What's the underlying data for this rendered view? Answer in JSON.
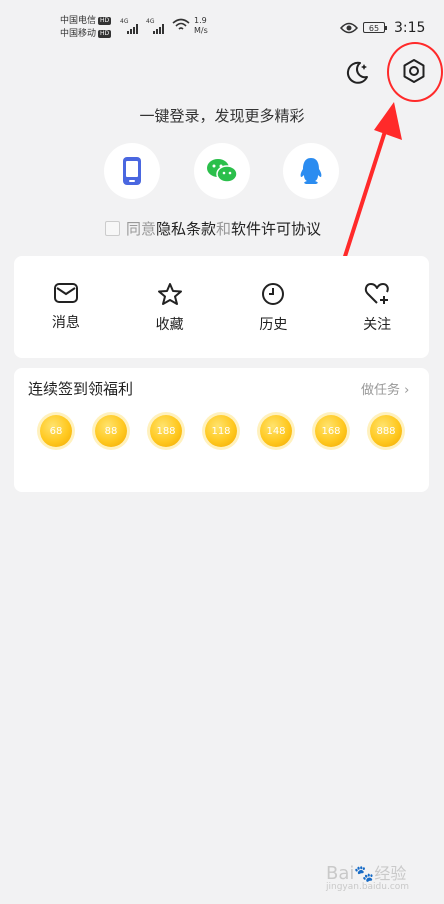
{
  "status_bar": {
    "carrier1": "中国电信",
    "carrier2": "中国移动",
    "hd": "HD",
    "net_4g": "4G",
    "speed_value": "1.9",
    "speed_unit": "M/s",
    "battery": "65",
    "time": "3:15"
  },
  "login": {
    "title": "一键登录，发现更多精彩",
    "options": [
      {
        "name": "phone",
        "icon": "phone-icon",
        "color": "#4a67e0"
      },
      {
        "name": "wechat",
        "icon": "wechat-icon",
        "color": "#2bbf4b"
      },
      {
        "name": "qq",
        "icon": "qq-icon",
        "color": "#2b8cf0"
      }
    ],
    "agree_prefix": "同意",
    "privacy": "隐私条款",
    "and": "和",
    "license": "软件许可协议"
  },
  "quick_actions": [
    {
      "label": "消息",
      "icon": "envelope-icon"
    },
    {
      "label": "收藏",
      "icon": "star-icon"
    },
    {
      "label": "历史",
      "icon": "clock-icon"
    },
    {
      "label": "关注",
      "icon": "heart-plus-icon"
    }
  ],
  "checkin": {
    "title": "连续签到领福利",
    "task_label": "做任务",
    "coins": [
      "68",
      "88",
      "188",
      "118",
      "148",
      "168",
      "888"
    ]
  },
  "watermark": {
    "brand": "Bai",
    "brand_cn": "经验",
    "url": "jingyan.baidu.com"
  },
  "colors": {
    "annotation": "#ff2a2a",
    "coin": "#ffc81f",
    "background": "#f2f2f3"
  }
}
